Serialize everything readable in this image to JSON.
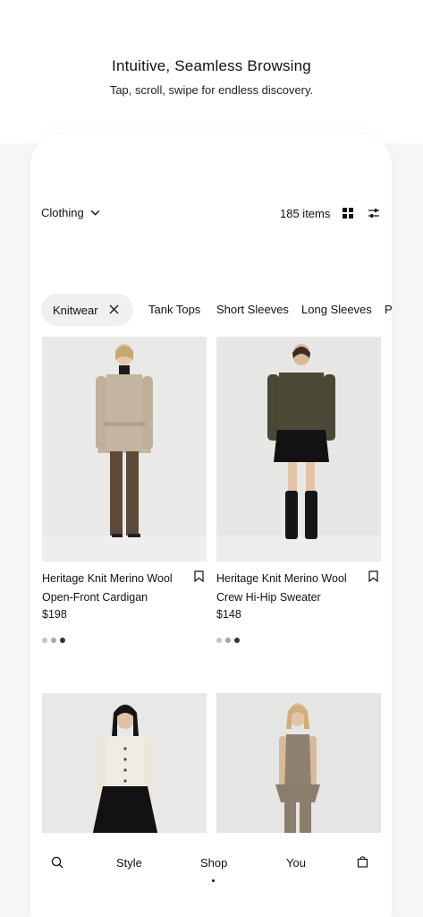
{
  "promo": {
    "headline": "Intuitive, Seamless Browsing",
    "subhead": "Tap, scroll, swipe for endless discovery."
  },
  "topbar": {
    "category": "Clothing",
    "count": "185 items",
    "icons": [
      "chevron-down-icon",
      "grid-icon",
      "filter-sliders-icon"
    ]
  },
  "chips": {
    "active": "Knitwear",
    "items": [
      "Tank Tops",
      "Short Sleeves",
      "Long Sleeves",
      "P"
    ]
  },
  "products": [
    {
      "name_line1": "Heritage Knit Merino Wool",
      "name_line2": "Open-Front Cardigan",
      "price": "$198",
      "swatches": [
        "#c8c4bc",
        "#a8a6a2",
        "#333333"
      ]
    },
    {
      "name_line1": "Heritage Knit Merino Wool",
      "name_line2": "Crew Hi-Hip Sweater",
      "price": "$148",
      "swatches": [
        "#c8c4bc",
        "#a8a6a2",
        "#333333"
      ]
    }
  ],
  "nav": {
    "style": "Style",
    "shop": "Shop",
    "you": "You"
  },
  "colors": {
    "background": "#f7f7f7",
    "card": "#ffffff",
    "chip_active": "#f0f0f0",
    "text": "#111111"
  }
}
